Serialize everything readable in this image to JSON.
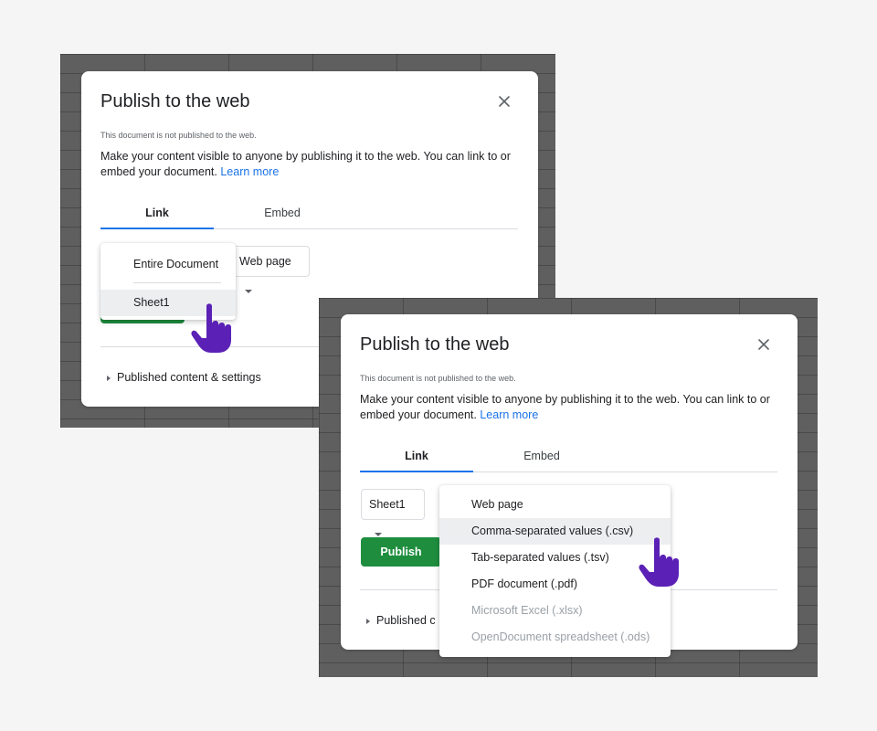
{
  "dialog1": {
    "title": "Publish to the web",
    "status": "This document is not published to the web.",
    "description": "Make your content visible to anyone by publishing it to the web. You can link to or embed your document.",
    "learn_more": "Learn more",
    "tabs": [
      "Link",
      "Embed"
    ],
    "format_select": "Web page",
    "published_settings": "Published content & settings",
    "sheet_menu": {
      "items": [
        "Entire Document",
        "Sheet1"
      ],
      "highlighted": "Sheet1"
    }
  },
  "dialog2": {
    "title": "Publish to the web",
    "status": "This document is not published to the web.",
    "description": "Make your content visible to anyone by publishing it to the web. You can link to or embed your document.",
    "learn_more": "Learn more",
    "tabs": [
      "Link",
      "Embed"
    ],
    "sheet_select": "Sheet1",
    "publish_button": "Publish",
    "published_settings": "Published content & settings",
    "published_settings_visible": "Published c",
    "format_menu": {
      "items": [
        {
          "label": "Web page",
          "enabled": true
        },
        {
          "label": "Comma-separated values (.csv)",
          "enabled": true
        },
        {
          "label": "Tab-separated values (.tsv)",
          "enabled": true
        },
        {
          "label": "PDF document (.pdf)",
          "enabled": true
        },
        {
          "label": "Microsoft Excel (.xlsx)",
          "enabled": false
        },
        {
          "label": "OpenDocument spreadsheet (.ods)",
          "enabled": false
        }
      ],
      "highlighted": "Comma-separated values (.csv)"
    }
  },
  "colors": {
    "accent_blue": "#1a73e8",
    "publish_green": "#1e8e3e",
    "cursor_purple": "#5b21b6",
    "sheet_background": "#5f5f5f"
  },
  "icons": [
    "close-icon",
    "dropdown-caret-icon",
    "expand-triangle-icon",
    "pointing-hand-cursor-icon"
  ]
}
